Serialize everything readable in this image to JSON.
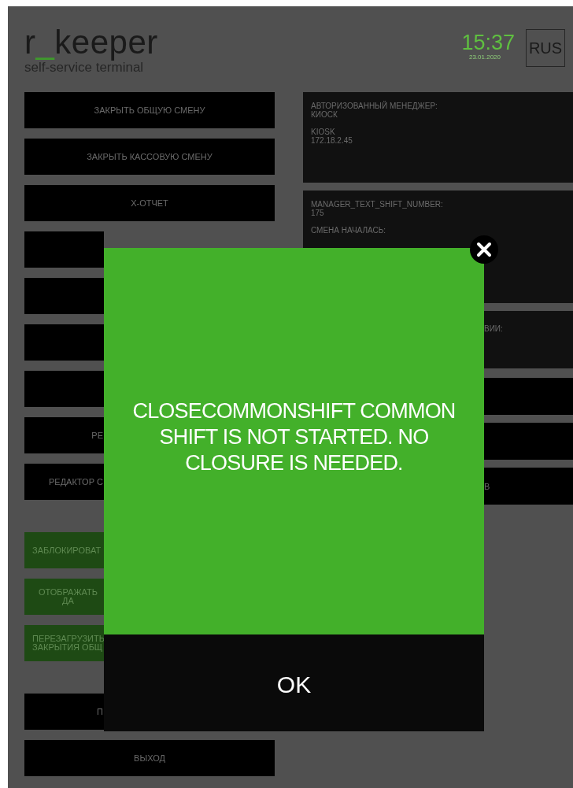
{
  "header": {
    "logo": {
      "before": "r",
      "accent": "_",
      "after": "keeper"
    },
    "subtitle": "self-service terminal",
    "time": "15:37",
    "date": "23.01.2020",
    "language": "RUS"
  },
  "left_buttons": [
    {
      "label": "ЗАКРЫТЬ ОБЩУЮ СМЕНУ",
      "kind": "plain"
    },
    {
      "label": "ЗАКРЫТЬ КАССОВУЮ СМЕНУ",
      "kind": "plain"
    },
    {
      "label": "X-ОТЧЕТ",
      "kind": "plain"
    },
    {
      "kind": "covered"
    },
    {
      "kind": "covered"
    },
    {
      "kind": "covered"
    },
    {
      "kind": "covered"
    },
    {
      "label": "РЕ",
      "kind": "covered"
    },
    {
      "label": "РЕДАКТОР С",
      "kind": "covered"
    }
  ],
  "toggle_buttons": [
    {
      "label": "ЗАБЛОКИРОВАТ"
    },
    {
      "label": "ОТОБРАЖАТЬ ДА"
    },
    {
      "label": "ПЕРЕЗАГРУЗИТЬ\nЗАКРЫТИЯ ОБЩ"
    }
  ],
  "bottom_buttons": [
    {
      "label": "П",
      "kind": "covered"
    },
    {
      "label": "ВЫХОД",
      "kind": "plain"
    }
  ],
  "info_panels": [
    {
      "kind": "plain",
      "groups": [
        [
          "АВТОРИЗОВАННЫЙ МЕНЕДЖЕР:",
          "КИОСК"
        ],
        [
          "KIOSK",
          "172.18.2.45"
        ]
      ]
    },
    {
      "kind": "plain",
      "groups": [
        [
          "MANAGER_TEXT_SHIFT_NUMBER:",
          "175"
        ],
        [
          "СМЕНА НАЧАЛАСЬ:"
        ]
      ]
    },
    {
      "kind": "covered",
      "groups": [
        [
          "ВИИ:"
        ]
      ]
    }
  ],
  "right_buttons": [
    {
      "kind": "covered"
    },
    {
      "kind": "covered"
    },
    {
      "kind": "covered",
      "label": "В"
    }
  ],
  "dialog": {
    "message": "CLOSECOMMONSHIFT COMMON SHIFT IS NOT STARTED. NO CLOSURE IS NEEDED.",
    "ok": "OK"
  }
}
